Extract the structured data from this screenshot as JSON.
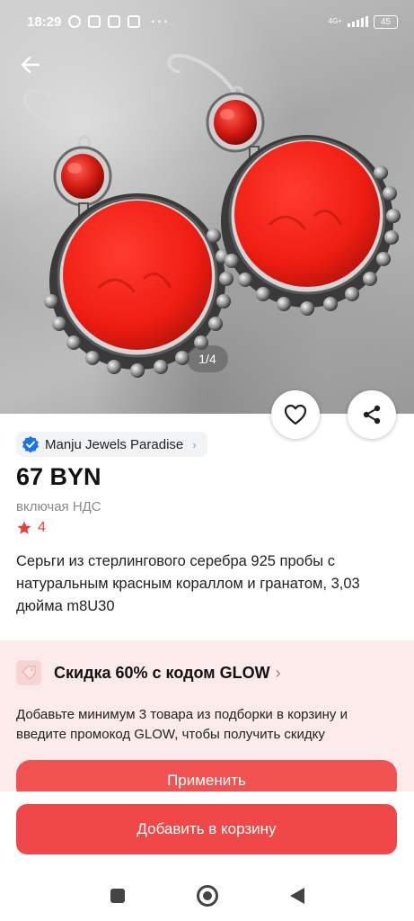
{
  "status_bar": {
    "time": "18:29",
    "network": "4G+",
    "battery": "45"
  },
  "gallery": {
    "pager": "1/4"
  },
  "store": {
    "name": "Manju Jewels Paradise"
  },
  "product": {
    "price": "67 BYN",
    "vat_note": "включая НДС",
    "rating": "4",
    "title": "Серьги из стерлингового серебра 925 пробы с натуральным красным кораллом и гранатом, 3,03 дюйма m8U30"
  },
  "promo": {
    "title": "Скидка 60% с кодом GLOW",
    "description": "Добавьте минимум 3 товара из подборки в корзину и введите промокод GLOW, чтобы получить скидку",
    "apply_label": "Применить"
  },
  "actions": {
    "add_to_cart": "Добавить в корзину"
  },
  "colors": {
    "accent": "#f04848",
    "promo_bg": "#fdeaea",
    "rating": "#e8413b",
    "verified": "#1a73e8"
  }
}
